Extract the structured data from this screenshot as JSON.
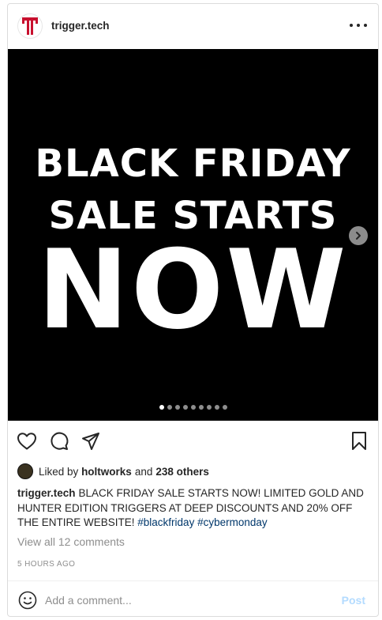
{
  "post": {
    "username": "trigger.tech",
    "avatar_icon": "trigger-tech-logo",
    "media": {
      "line1": "BLACK FRIDAY",
      "line2": "SALE STARTS",
      "line3": "NOW",
      "slide_count": 9,
      "active_slide": 1
    },
    "actions": {
      "like_icon": "heart-icon",
      "comment_icon": "comment-icon",
      "share_icon": "share-icon",
      "save_icon": "bookmark-icon"
    },
    "likes": {
      "prefix": "Liked by",
      "user": "holtworks",
      "conjunction": "and",
      "others": "238 others"
    },
    "caption": {
      "user": "trigger.tech",
      "text": "BLACK FRIDAY SALE STARTS NOW! LIMITED GOLD AND HUNTER EDITION TRIGGERS AT DEEP DISCOUNTS AND 20% OFF THE ENTIRE WEBSITE!",
      "hashtags": [
        "#blackfriday",
        "#cybermonday"
      ]
    },
    "view_comments": "View all 12 comments",
    "timestamp": "5 HOURS AGO",
    "comment_box": {
      "placeholder": "Add a comment...",
      "post_label": "Post"
    }
  },
  "colors": {
    "accent_red": "#c8102e",
    "hashtag": "#00376b",
    "post_disabled": "#b3dbff"
  }
}
